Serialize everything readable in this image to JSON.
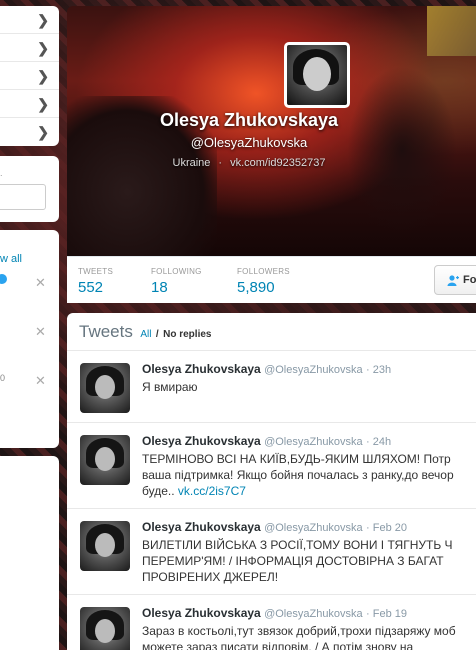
{
  "sidebar": {
    "menu_chevron": "❯",
    "search_label": ".",
    "view_all": "w all",
    "close_glyph": "✕",
    "zero_label": "0"
  },
  "profile": {
    "name": "Olesya Zhukovskaya",
    "handle": "@OlesyaZhukovska",
    "location": "Ukraine",
    "meta_sep": "·",
    "url": "vk.com/id92352737"
  },
  "stats": {
    "tweets_label": "TWEETS",
    "tweets_value": "552",
    "following_label": "FOLLOWING",
    "following_value": "18",
    "followers_label": "FOLLOWERS",
    "followers_value": "5,890",
    "follow_button": "Fo"
  },
  "timeline": {
    "title": "Tweets",
    "filter_all": "All",
    "filter_sep": "/",
    "filter_no_replies": "No replies",
    "tweets": [
      {
        "name": "Olesya Zhukovskaya",
        "handle": "@OlesyaZhukovska",
        "time": "· 23h",
        "text": "Я вмираю",
        "link": ""
      },
      {
        "name": "Olesya Zhukovskaya",
        "handle": "@OlesyaZhukovska",
        "time": "· 24h",
        "text": "ТЕРМІНОВО ВСІ НА КИЇВ,БУДЬ-ЯКИМ ШЛЯХОМ! Потр ваша підтримка! Якщо бойня почалась з ранку,до вечор буде..",
        "link": "vk.cc/2is7C7"
      },
      {
        "name": "Olesya Zhukovskaya",
        "handle": "@OlesyaZhukovska",
        "time": "· Feb 20",
        "text": "ВИЛЕТІЛИ ВІЙСЬКА З РОСІЇ,ТОМУ ВОНИ І ТЯГНУТЬ Ч ПЕРЕМИР'ЯМ! / ІНФОРМАЦІЯ ДОСТОВІРНА З БАГАТ ПРОВІРЕНИХ ДЖЕРЕЛ!",
        "link": ""
      },
      {
        "name": "Olesya Zhukovskaya",
        "handle": "@OlesyaZhukovska",
        "time": "· Feb 19",
        "text": "Зараз в костьолі,тут звязок добрий,трохи підзаряжу моб можете зараз писати відповім. / А потім знову на",
        "link": ""
      }
    ]
  },
  "colors": {
    "link_blue": "#0084b4",
    "muted_gray": "#8899a6",
    "header_red": "#c0301e"
  },
  "icons": [
    "chevron-right-icon",
    "verified-icon",
    "close-icon",
    "follow-user-icon"
  ]
}
